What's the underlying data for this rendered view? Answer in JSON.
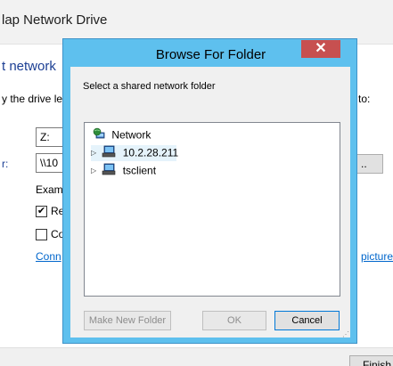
{
  "wizard": {
    "title": "lap Network Drive",
    "heading": "t network",
    "instruction_left": "y the drive le",
    "instruction_right": "to:",
    "drive_value": "Z:",
    "folder_label": "r:",
    "folder_value": "\\\\10",
    "browse_label": "..",
    "example_label": "Exam",
    "reconnect_label": "Re",
    "reconnect_checked": true,
    "credentials_label": "Co",
    "credentials_checked": false,
    "link_left": "Conn",
    "link_right": "picture",
    "finish_label": "Finish"
  },
  "dialog": {
    "title": "Browse For Folder",
    "close_glyph": "✕",
    "description": "Select a shared network folder",
    "tree": [
      {
        "label": "Network",
        "icon": "network-globe-icon",
        "expandable": false
      },
      {
        "label": "10.2.28.211",
        "icon": "computer-icon",
        "expandable": true,
        "selected": true
      },
      {
        "label": "tsclient",
        "icon": "computer-icon",
        "expandable": true
      }
    ],
    "buttons": {
      "new_folder": "Make New Folder",
      "ok": "OK",
      "cancel": "Cancel"
    }
  },
  "colors": {
    "dialog_frame": "#5ec0ee",
    "close_button": "#c75050",
    "link": "#0066cc",
    "heading": "#1c3f94"
  }
}
